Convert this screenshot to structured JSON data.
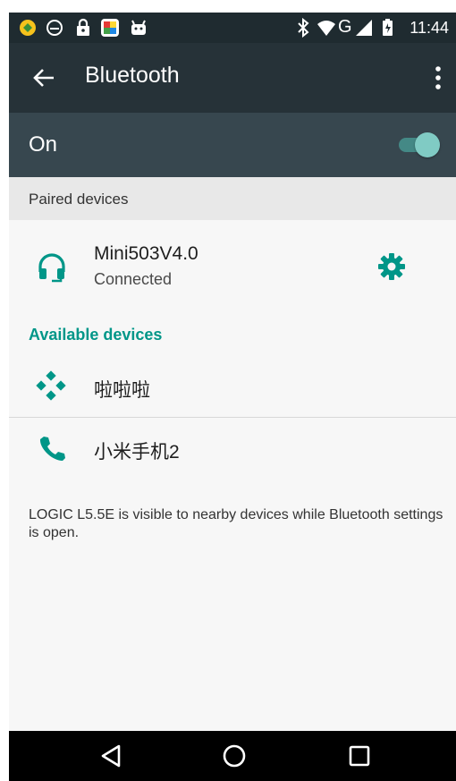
{
  "status_bar": {
    "time": "11:44",
    "icons_left": [
      "app-icon",
      "ghost-icon",
      "lock-icon",
      "launcher-icon",
      "android-icon"
    ],
    "icons_right": [
      "bluetooth-icon",
      "wifi-icon",
      "network-type-label",
      "signal-icon",
      "battery-icon"
    ],
    "network_type": "G"
  },
  "app_bar": {
    "title": "Bluetooth"
  },
  "toggle": {
    "label": "On",
    "state": true
  },
  "paired": {
    "header": "Paired devices",
    "devices": [
      {
        "name": "Mini503V4.0",
        "status": "Connected",
        "icon": "headphones-icon"
      }
    ]
  },
  "available": {
    "header": "Available devices",
    "devices": [
      {
        "name": "啦啦啦",
        "icon": "gamepad-icon"
      },
      {
        "name": "小米手机2",
        "icon": "phone-icon"
      }
    ]
  },
  "footnote": "LOGIC L5.5E is visible to nearby devices while Bluetooth settings is open.",
  "colors": {
    "status_bar": "#1f2b30",
    "app_bar": "#263238",
    "toggle_row": "#37474f",
    "accent": "#009688",
    "switch_thumb": "#80cbc4"
  },
  "nav_bar": {
    "buttons": [
      "back-icon",
      "home-icon",
      "recents-icon"
    ]
  }
}
